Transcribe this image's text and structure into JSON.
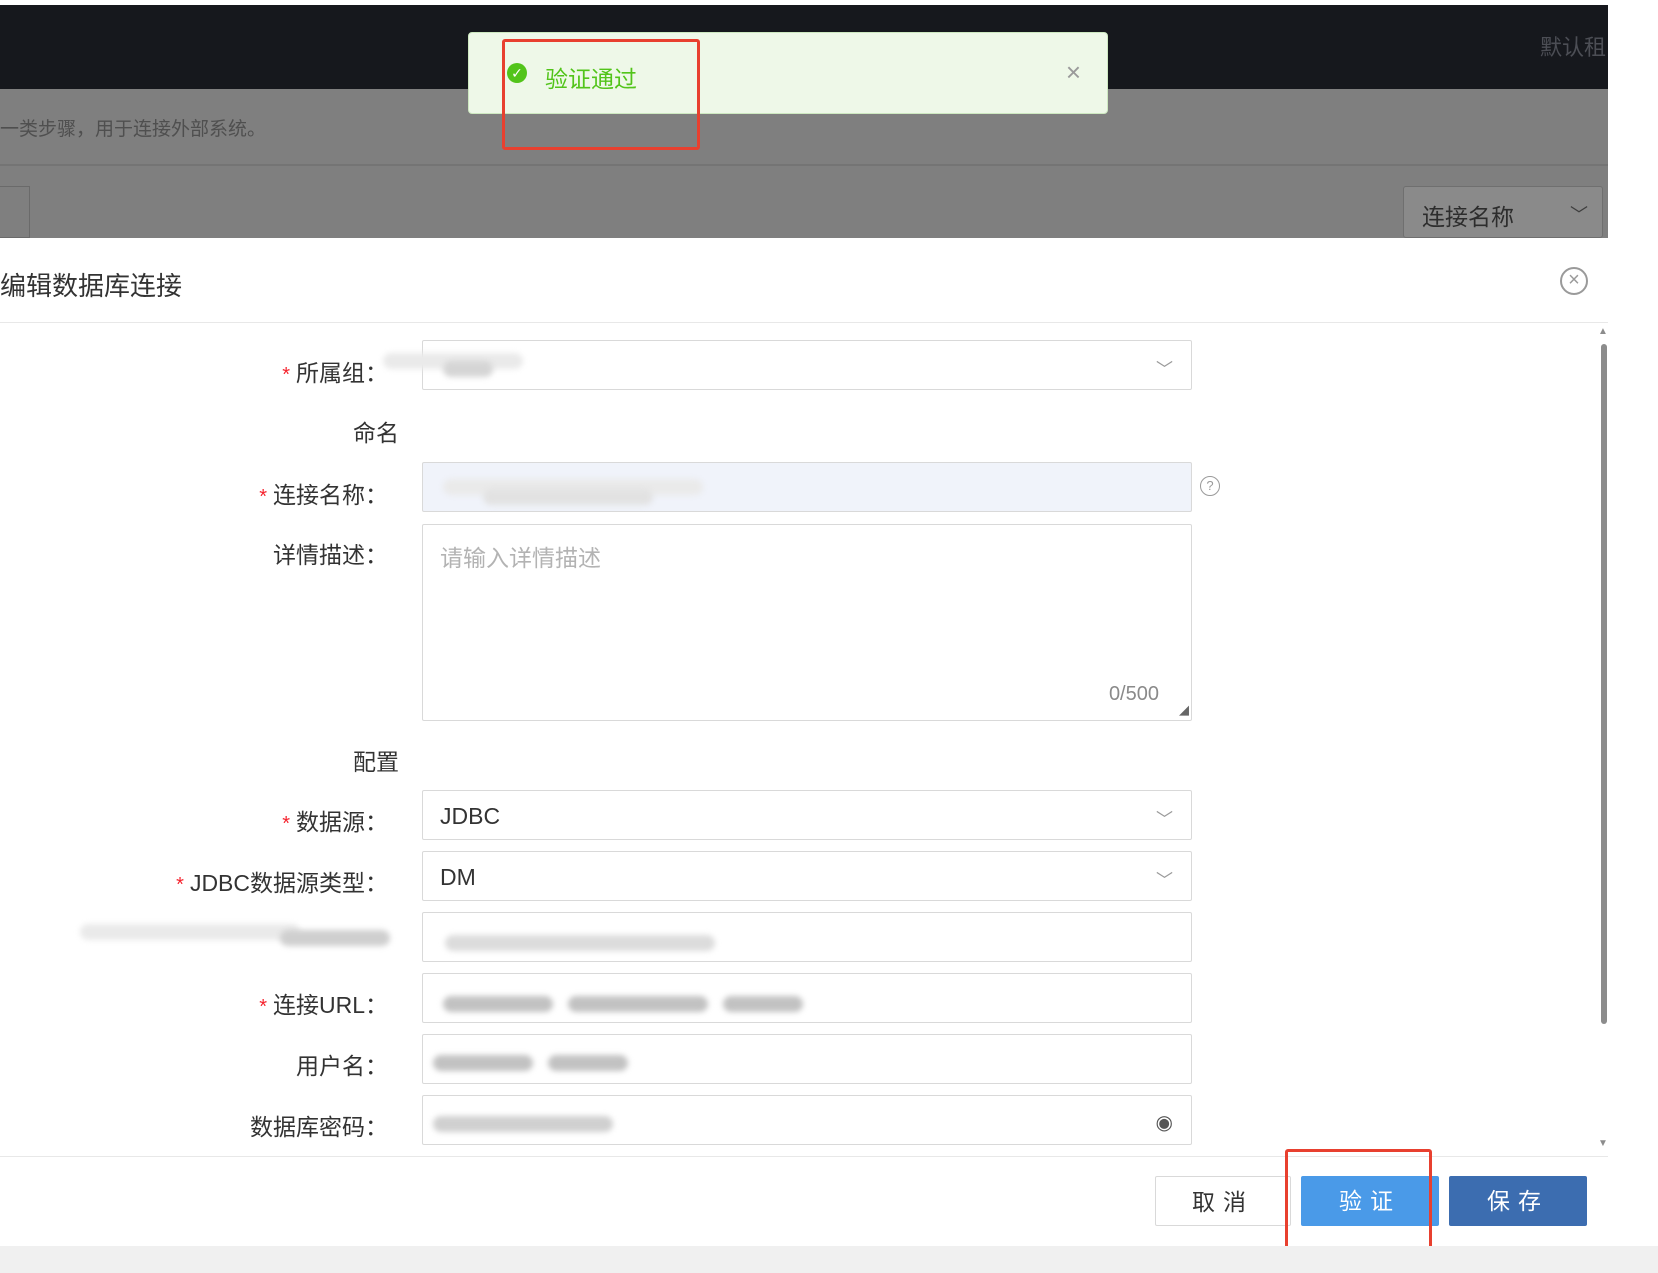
{
  "header": {
    "tenant_text": "默认租",
    "page_desc": "一类步骤，用于连接外部系统。",
    "filter_select_value": "连接名称"
  },
  "toast": {
    "message": "验证通过",
    "close_label": "×"
  },
  "modal": {
    "title": "编辑数据库连接",
    "close_label": "×",
    "sections": {
      "naming": "命名",
      "config": "配置"
    },
    "fields": {
      "group_label": "所属组：",
      "name_label": "连接名称：",
      "desc_label": "详情描述：",
      "desc_placeholder": "请输入详情描述",
      "desc_count": "0/500",
      "datasource_label": "数据源：",
      "datasource_value": "JDBC",
      "jdbc_type_label": "JDBC数据源类型：",
      "jdbc_type_value": "DM",
      "url_label": "连接URL：",
      "username_label": "用户名：",
      "password_label": "数据库密码："
    },
    "required_mark": "*",
    "help_icon_text": "?",
    "footer": {
      "cancel_label": "取消",
      "verify_label": "验证",
      "save_label": "保存"
    }
  },
  "icons": {
    "success": "check-circle-icon",
    "chevron": "chevron-down-icon",
    "eye": "eye-icon",
    "help": "question-circle-icon",
    "close": "close-icon"
  },
  "colors": {
    "success_green": "#52c41a",
    "toast_bg": "#eef8e8",
    "verify_button": "#4a9ae8",
    "save_button": "#3c6db0",
    "highlight_red": "#e8402f",
    "required_red": "#f5222d"
  }
}
